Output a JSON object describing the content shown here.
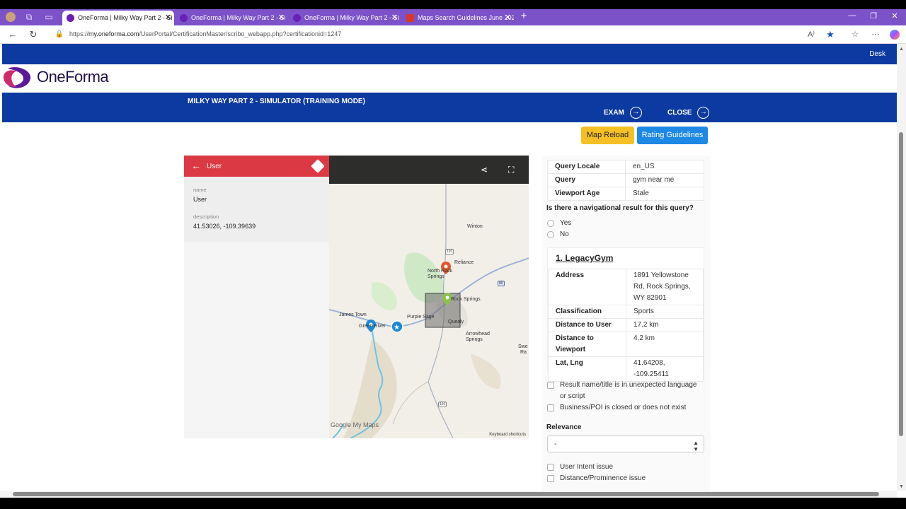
{
  "tabs": [
    {
      "title": "OneForma | Milky Way Part 2 - Si",
      "active": true
    },
    {
      "title": "OneForma | Milky Way Part 2 - Si",
      "active": false
    },
    {
      "title": "OneForma | Milky Way Part 2 - Si",
      "active": false
    },
    {
      "title": "Maps Search Guidelines June 202",
      "active": false
    }
  ],
  "address": {
    "prefix": "https://",
    "host": "my.oneforma.com",
    "path": "/UserPortal/CertificationMaster/scribo_webapp.php?certificationid=1247"
  },
  "site": {
    "desk": "Desk",
    "logo": "OneForma"
  },
  "header": {
    "title": "MILKY WAY PART 2 - SIMULATOR (TRAINING MODE)",
    "exam": "EXAM",
    "close": "CLOSE"
  },
  "buttons": {
    "map_reload": "Map Reload",
    "rating_guidelines": "Rating Guidelines"
  },
  "map_panel": {
    "title": "User",
    "name_label": "name",
    "name_value": "User",
    "desc_label": "description",
    "desc_value": "41.53026, -109.39639"
  },
  "map": {
    "labels": [
      "Winton",
      "Reliance",
      "North Rock Springs",
      "Rock Springs",
      "James Town",
      "Green River",
      "Purple Sage",
      "Quealy",
      "Arrowhead Springs",
      "Swe",
      "Ra",
      "191",
      "80"
    ],
    "google": "Google My Maps",
    "keyboard": "Keyboard shortcuts",
    "colors": {
      "water": "#6fc3df",
      "road": "#9aa3b5",
      "green": "#c9e8c0"
    }
  },
  "query_info": [
    {
      "key": "Query Locale",
      "value": "en_US"
    },
    {
      "key": "Query",
      "value": "gym near me"
    },
    {
      "key": "Viewport Age",
      "value": "Stale"
    }
  ],
  "nav_question": "Is there a navigational result for this query?",
  "nav_options": [
    "Yes",
    "No"
  ],
  "result": {
    "title": "1. LegacyGym",
    "rows": [
      {
        "key": "Address",
        "value": "1891 Yellowstone Rd, Rock Springs, WY 82901"
      },
      {
        "key": "Classification",
        "value": "Sports"
      },
      {
        "key": "Distance to User",
        "value": "17.2 km"
      },
      {
        "key": "Distance to Viewport",
        "value": "4.2 km"
      },
      {
        "key": "Lat, Lng",
        "value": "41.64208, -109.25411"
      }
    ]
  },
  "checks1": [
    "Result name/title is in unexpected language or script",
    "Business/POI is closed or does not exist"
  ],
  "relevance": {
    "label": "Relevance",
    "selected": "-"
  },
  "checks2": [
    "User Intent issue",
    "Distance/Prominence issue"
  ]
}
